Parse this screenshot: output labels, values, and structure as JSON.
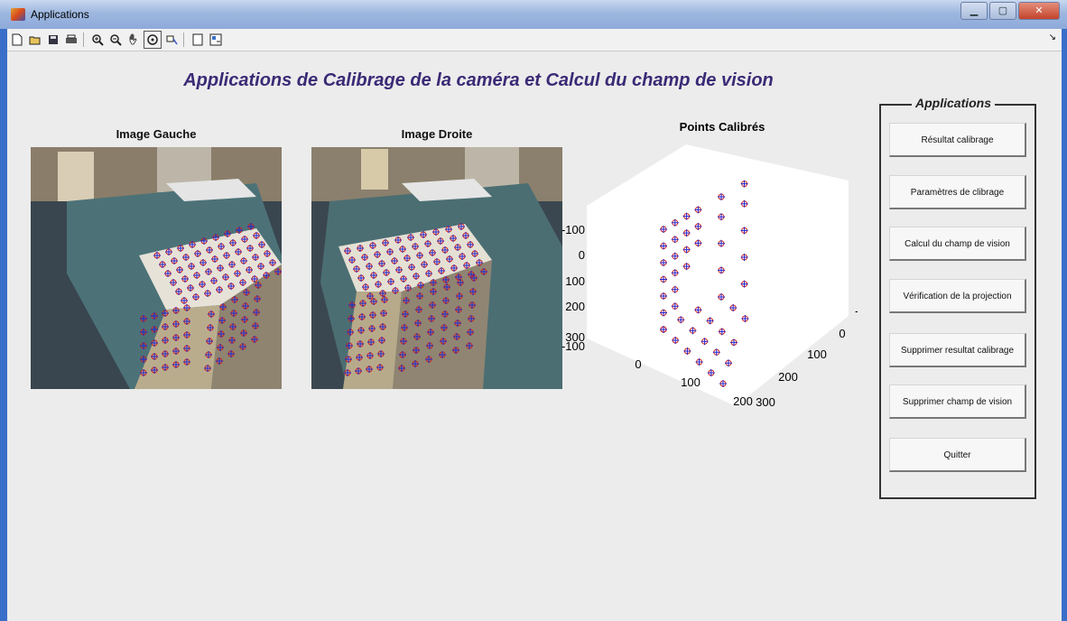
{
  "window": {
    "title": "Applications"
  },
  "toolbar": {
    "icons": [
      "new-icon",
      "open-icon",
      "save-icon",
      "print-icon",
      "zoom-in-icon",
      "zoom-out-icon",
      "pan-icon",
      "rotate-icon",
      "data-cursor-icon",
      "hide-plot-tools-icon",
      "show-plot-tools-icon"
    ],
    "right_glyph": "↘"
  },
  "main_title": "Applications de Calibrage de la caméra et Calcul du champ de vision",
  "left_image": {
    "label": "Image Gauche"
  },
  "right_image": {
    "label": "Image Droite"
  },
  "chart_data": {
    "type": "scatter",
    "title": "Points Calibrés",
    "x_ticks": [
      "0",
      "100",
      "200"
    ],
    "y_ticks": [
      "-100",
      "0",
      "100",
      "200",
      "300"
    ],
    "z_ticks": [
      "-100",
      "0",
      "100",
      "200",
      "300"
    ],
    "x_range": [
      -100,
      200
    ],
    "y_range": [
      -100,
      300
    ],
    "z_range": [
      -100,
      300
    ],
    "series": [
      {
        "marker": "o",
        "color": "#cc2222"
      },
      {
        "marker": "+",
        "color": "#2222cc"
      }
    ],
    "points": [
      [
        0,
        0,
        300
      ],
      [
        0,
        0,
        250
      ],
      [
        0,
        0,
        200
      ],
      [
        0,
        0,
        150
      ],
      [
        0,
        0,
        100
      ],
      [
        0,
        0,
        50
      ],
      [
        0,
        0,
        0
      ],
      [
        0,
        40,
        300
      ],
      [
        0,
        40,
        250
      ],
      [
        0,
        40,
        200
      ],
      [
        0,
        40,
        150
      ],
      [
        0,
        40,
        100
      ],
      [
        0,
        40,
        50
      ],
      [
        0,
        80,
        300
      ],
      [
        0,
        80,
        250
      ],
      [
        0,
        80,
        200
      ],
      [
        0,
        80,
        150
      ],
      [
        0,
        120,
        300
      ],
      [
        0,
        120,
        250
      ],
      [
        0,
        120,
        200
      ],
      [
        0,
        0,
        0
      ],
      [
        40,
        0,
        0
      ],
      [
        80,
        0,
        0
      ],
      [
        120,
        0,
        0
      ],
      [
        160,
        0,
        0
      ],
      [
        200,
        0,
        0
      ],
      [
        0,
        60,
        0
      ],
      [
        40,
        60,
        0
      ],
      [
        80,
        60,
        0
      ],
      [
        120,
        60,
        0
      ],
      [
        160,
        60,
        0
      ],
      [
        0,
        120,
        0
      ],
      [
        40,
        120,
        0
      ],
      [
        80,
        120,
        0
      ],
      [
        120,
        120,
        0
      ],
      [
        0,
        200,
        0
      ],
      [
        40,
        200,
        0
      ],
      [
        80,
        200,
        0
      ],
      [
        0,
        200,
        80
      ],
      [
        0,
        200,
        160
      ],
      [
        0,
        200,
        240
      ],
      [
        0,
        200,
        300
      ],
      [
        0,
        280,
        0
      ],
      [
        0,
        280,
        80
      ],
      [
        0,
        280,
        160
      ],
      [
        0,
        280,
        240
      ],
      [
        0,
        280,
        300
      ]
    ]
  },
  "panel": {
    "title": "Applications",
    "buttons": [
      "Résultat calibrage",
      "Paramètres de clibrage",
      "Calcul du champ de vision",
      "Vérification de la projection",
      "Supprimer resultat calibrage",
      "Supprimer champ de vision",
      "Quitter"
    ]
  }
}
